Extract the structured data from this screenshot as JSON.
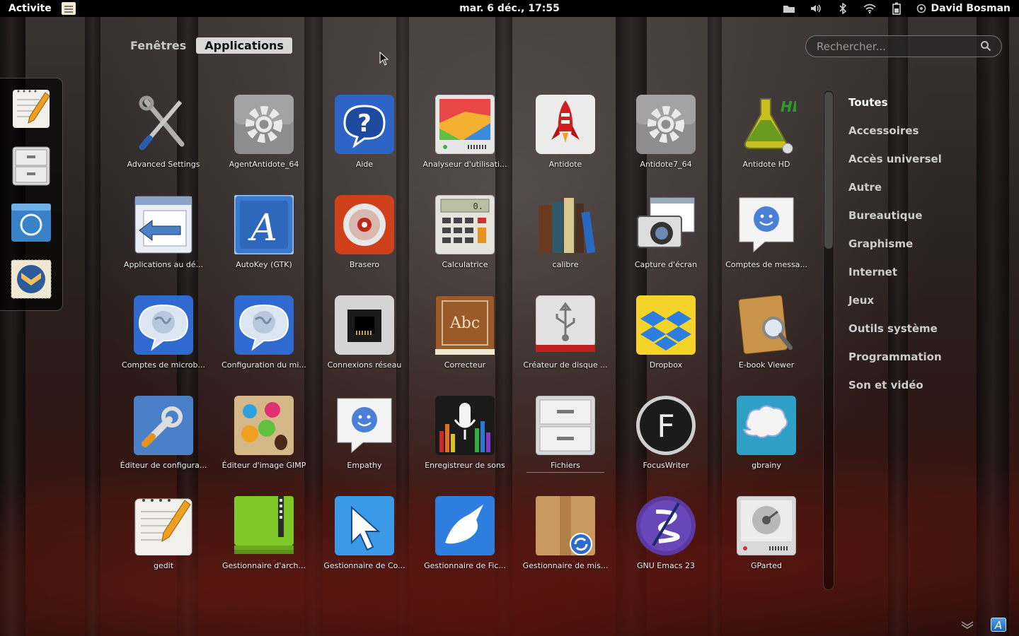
{
  "topbar": {
    "activities_label": "Activite",
    "clock": "mar.  6 déc., 17:55",
    "user_name": "David Bosman",
    "status_icons": [
      "folder-icon",
      "volume-icon",
      "bluetooth-icon",
      "wifi-icon",
      "battery-icon",
      "user-status-icon"
    ]
  },
  "dash": {
    "items": [
      "gedit",
      "Fichiers",
      "Chromium",
      "Thunderbird"
    ]
  },
  "view_selector": {
    "tabs": [
      "Fenêtres",
      "Applications"
    ],
    "active": "Applications"
  },
  "search": {
    "placeholder": "Rechercher..."
  },
  "apps": [
    {
      "label": "Advanced Settings",
      "icon": "tools-icon"
    },
    {
      "label": "AgentAntidote_64",
      "icon": "gear-icon"
    },
    {
      "label": "Aide",
      "icon": "help-icon"
    },
    {
      "label": "Analyseur d'utilisati...",
      "icon": "disk-usage-icon"
    },
    {
      "label": "Antidote",
      "icon": "rocket-icon"
    },
    {
      "label": "Antidote7_64",
      "icon": "gear-icon"
    },
    {
      "label": "Antidote HD",
      "icon": "flask-icon"
    },
    {
      "label": "Applications au dé...",
      "icon": "startup-apps-icon"
    },
    {
      "label": "AutoKey (GTK)",
      "icon": "autokey-icon"
    },
    {
      "label": "Brasero",
      "icon": "disc-icon"
    },
    {
      "label": "Calculatrice",
      "icon": "calculator-icon"
    },
    {
      "label": "calibre",
      "icon": "books-icon"
    },
    {
      "label": "Capture d'écran",
      "icon": "camera-icon"
    },
    {
      "label": "Comptes de messa...",
      "icon": "chat-smiley-icon"
    },
    {
      "label": "Comptes de microb...",
      "icon": "globe-bubble-icon"
    },
    {
      "label": "Configuration du mi...",
      "icon": "globe-bubble-icon"
    },
    {
      "label": "Connexions réseau",
      "icon": "network-icon"
    },
    {
      "label": "Correcteur",
      "icon": "dictionary-icon"
    },
    {
      "label": "Créateur de disque ...",
      "icon": "usb-icon"
    },
    {
      "label": "Dropbox",
      "icon": "dropbox-icon"
    },
    {
      "label": "E-book Viewer",
      "icon": "ebook-icon"
    },
    {
      "label": "Éditeur de configura...",
      "icon": "wrench-icon"
    },
    {
      "label": "Éditeur d'image GIMP",
      "icon": "palette-icon"
    },
    {
      "label": "Empathy",
      "icon": "chat-smiley-icon"
    },
    {
      "label": "Enregistreur de sons",
      "icon": "microphone-icon"
    },
    {
      "label": "Fichiers",
      "icon": "file-cabinet-icon"
    },
    {
      "label": "FocusWriter",
      "icon": "focuswriter-icon"
    },
    {
      "label": "gbrainy",
      "icon": "brain-icon"
    },
    {
      "label": "gedit",
      "icon": "notepad-pencil-icon"
    },
    {
      "label": "Gestionnaire d'arch...",
      "icon": "archive-icon"
    },
    {
      "label": "Gestionnaire de Co...",
      "icon": "pointer-icon"
    },
    {
      "label": "Gestionnaire de Fic...",
      "icon": "marlin-icon"
    },
    {
      "label": "Gestionnaire de mis...",
      "icon": "package-update-icon"
    },
    {
      "label": "GNU Emacs 23",
      "icon": "emacs-icon"
    },
    {
      "label": "GParted",
      "icon": "disk-partition-icon"
    }
  ],
  "selected_app": "Fichiers",
  "categories": [
    "Toutes",
    "Accessoires",
    "Accès universel",
    "Autre",
    "Bureautique",
    "Graphisme",
    "Internet",
    "Jeux",
    "Outils système",
    "Programmation",
    "Son et vidéo"
  ],
  "active_category": "Toutes",
  "tray": {
    "app_letter": "A"
  },
  "colors": {
    "topbar_bg": "#000000",
    "tab_active_bg": "#d8d8d8",
    "overview_overlay": "rgba(0,0,0,0.65)"
  }
}
